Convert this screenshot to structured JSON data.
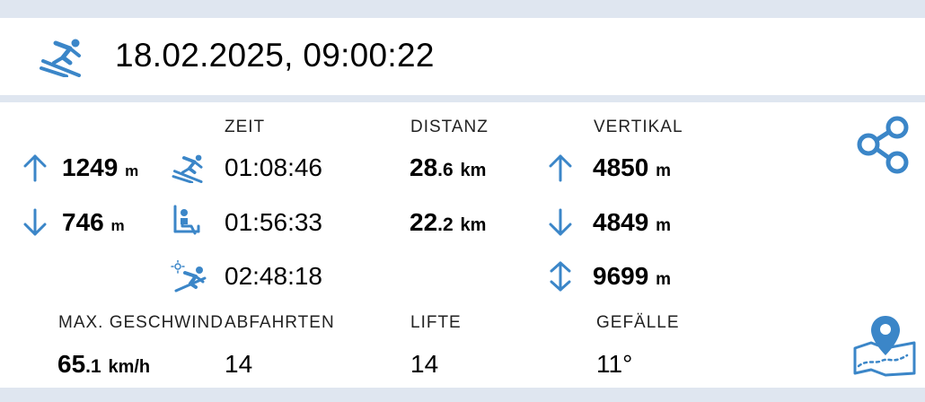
{
  "header": {
    "title": "18.02.2025, 09:00:22",
    "icon": "skier-icon"
  },
  "columns": {
    "zeit": "ZEIT",
    "distanz": "DISTANZ",
    "vertikal": "VERTIKAL"
  },
  "altitude": {
    "max": "1249",
    "max_unit": "m",
    "min": "746",
    "min_unit": "m"
  },
  "zeit": {
    "abfahrt": "01:08:46",
    "lift": "01:56:33",
    "gesamt": "02:48:18"
  },
  "distanz": {
    "abfahrt_int": "28",
    "abfahrt_dec": ".6",
    "abfahrt_unit": "km",
    "lift_int": "22",
    "lift_dec": ".2",
    "lift_unit": "km"
  },
  "vertikal": {
    "up": "4850",
    "down": "4849",
    "total": "9699",
    "unit": "m"
  },
  "bottom": {
    "max_speed_label": "MAX. GESCHWINDIGKEIT",
    "max_speed_int": "65",
    "max_speed_dec": ".1",
    "max_speed_unit": "km/h",
    "abfahrten_label": "ABFAHRTEN",
    "abfahrten": "14",
    "lifte_label": "LIFTE",
    "lifte": "14",
    "gefaelle_label": "GEFÄLLE",
    "gefaelle": "11°"
  },
  "colors": {
    "accent": "#3b86c8",
    "band": "#dfe6f0"
  }
}
